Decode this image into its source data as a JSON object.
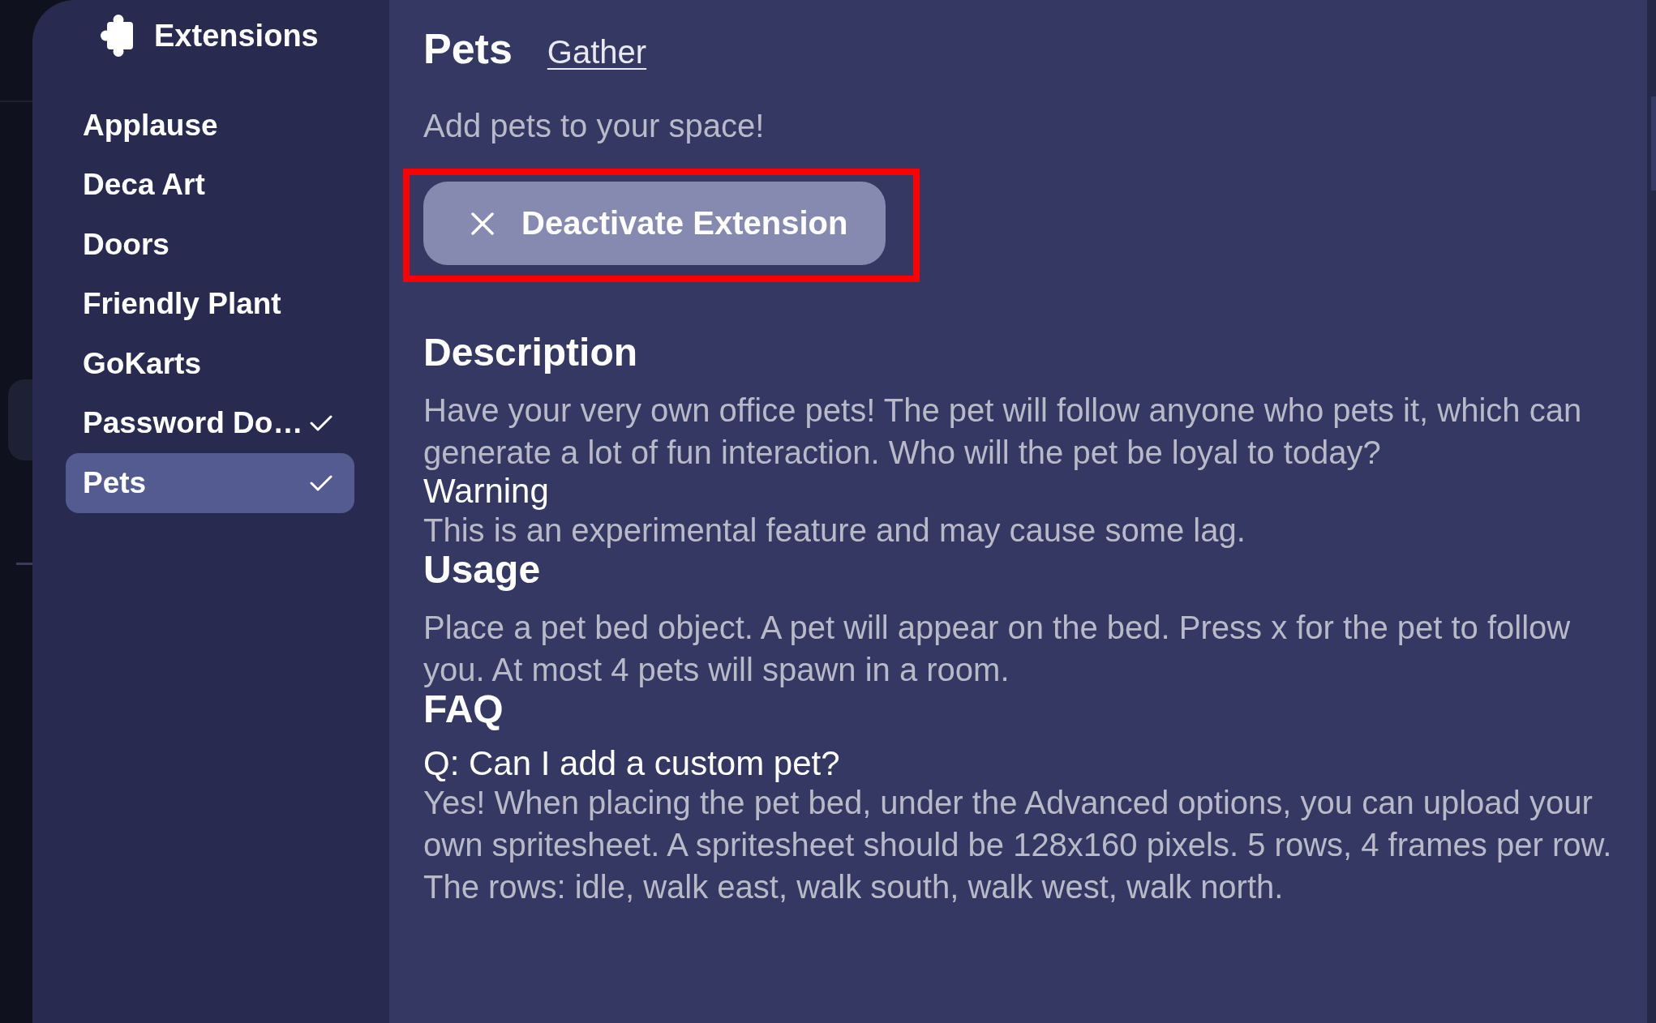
{
  "sidebar": {
    "title": "Extensions",
    "items": [
      {
        "label": "Applause",
        "enabled": false,
        "selected": false
      },
      {
        "label": "Deca Art",
        "enabled": false,
        "selected": false
      },
      {
        "label": "Doors",
        "enabled": false,
        "selected": false
      },
      {
        "label": "Friendly Plant",
        "enabled": false,
        "selected": false
      },
      {
        "label": "GoKarts",
        "enabled": false,
        "selected": false
      },
      {
        "label": "Password Do…",
        "enabled": true,
        "selected": false
      },
      {
        "label": "Pets",
        "enabled": true,
        "selected": true
      }
    ]
  },
  "header": {
    "title": "Pets",
    "link": "Gather"
  },
  "tagline": "Add pets to your space!",
  "action_button": {
    "label": "Deactivate Extension",
    "highlighted": true
  },
  "sections": [
    {
      "kind": "heading",
      "text": "Description"
    },
    {
      "kind": "paragraph",
      "text": "Have your very own office pets! The pet will follow anyone who pets it, which can generate a lot of fun interaction. Who will the pet be loyal to today?"
    },
    {
      "kind": "subheading",
      "text": "Warning"
    },
    {
      "kind": "paragraph",
      "text": "This is an experimental feature and may cause some lag."
    },
    {
      "kind": "heading",
      "text": "Usage"
    },
    {
      "kind": "paragraph",
      "text": "Place a pet bed object. A pet will appear on the bed. Press x for the pet to follow you. At most 4 pets will spawn in a room."
    },
    {
      "kind": "heading",
      "text": "FAQ"
    },
    {
      "kind": "subheading",
      "text": "Q: Can I add a custom pet?"
    },
    {
      "kind": "paragraph",
      "text": "Yes! When placing the pet bed, under the Advanced options, you can upload your own spritesheet. A spritesheet should be 128x160 pixels. 5 rows, 4 frames per row. The rows: idle, walk east, walk south, walk west, walk north."
    }
  ]
}
